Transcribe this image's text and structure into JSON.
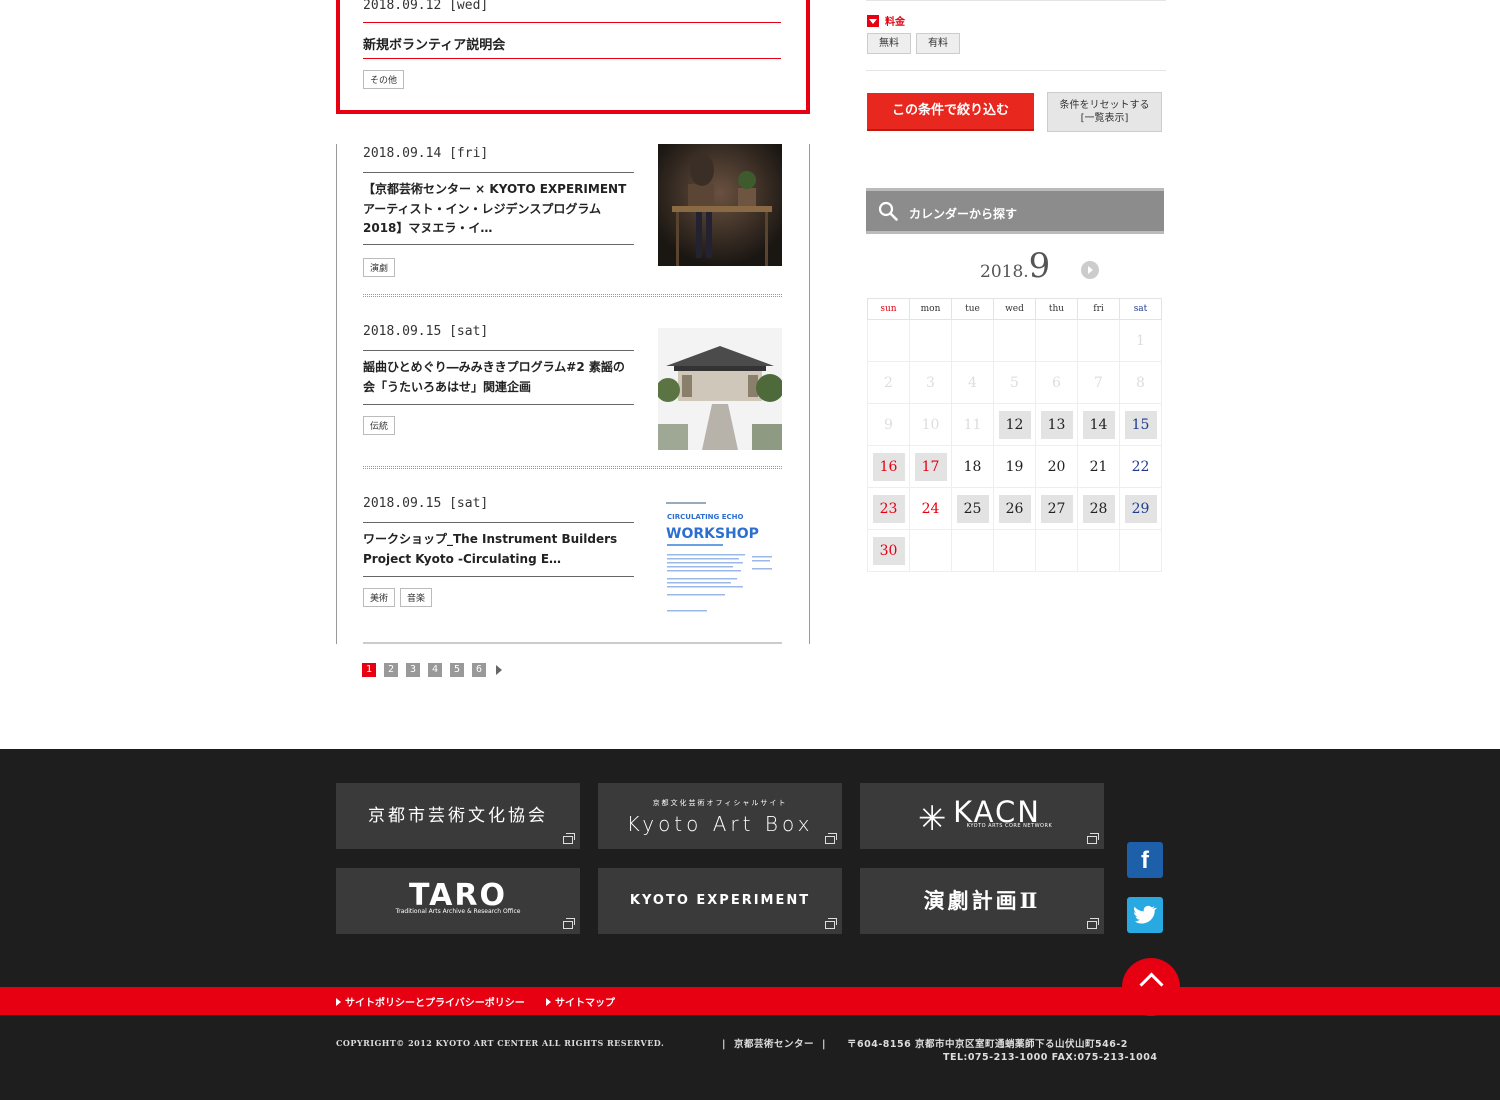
{
  "featured": {
    "date": "2018.09.12 [wed]",
    "title": "新規ボランティア説明会",
    "tags": [
      "その他"
    ]
  },
  "events": [
    {
      "date": "2018.09.14 [fri]",
      "title": "【京都芸術センター × KYOTO EXPERIMENT アーティスト・イン・レジデンスプログラム2018】マヌエラ・イ…",
      "tags": [
        "演劇"
      ]
    },
    {
      "date": "2018.09.15 [sat]",
      "title": "謡曲ひとめぐり―みみききプログラム#2 素謡の会「うたいろあはせ」関連企画",
      "tags": [
        "伝統"
      ]
    },
    {
      "date": "2018.09.15 [sat]",
      "title": "ワークショップ_The Instrument Builders Project Kyoto -Circulating E…",
      "tags": [
        "美術",
        "音楽"
      ],
      "poster": {
        "head": "CIRCULATING ECHO",
        "big": "WORKSHOP"
      }
    }
  ],
  "pagination": {
    "pages": [
      "1",
      "2",
      "3",
      "4",
      "5",
      "6"
    ],
    "current": "1"
  },
  "sidebar": {
    "fee_label": "料金",
    "fee_options": [
      "無料",
      "有料"
    ],
    "filter_button": "この条件で絞り込む",
    "reset_line1": "条件をリセットする",
    "reset_line2": "[一覧表示]"
  },
  "calendar": {
    "title": "カレンダーから探す",
    "year": "2018.",
    "month": "9",
    "weekdays": [
      "sun",
      "mon",
      "tue",
      "wed",
      "thu",
      "fri",
      "sat"
    ],
    "weeks": [
      [
        null,
        null,
        null,
        null,
        null,
        null,
        {
          "d": "1",
          "s": "off"
        }
      ],
      [
        {
          "d": "2",
          "s": "off"
        },
        {
          "d": "3",
          "s": "off"
        },
        {
          "d": "4",
          "s": "off"
        },
        {
          "d": "5",
          "s": "off"
        },
        {
          "d": "6",
          "s": "off"
        },
        {
          "d": "7",
          "s": "off"
        },
        {
          "d": "8",
          "s": "off"
        }
      ],
      [
        {
          "d": "9",
          "s": "off"
        },
        {
          "d": "10",
          "s": "off"
        },
        {
          "d": "11",
          "s": "off"
        },
        {
          "d": "12",
          "s": "ev"
        },
        {
          "d": "13",
          "s": "ev"
        },
        {
          "d": "14",
          "s": "ev"
        },
        {
          "d": "15",
          "s": "ev"
        }
      ],
      [
        {
          "d": "16",
          "s": "ev"
        },
        {
          "d": "17",
          "s": "ev-sun"
        },
        {
          "d": "18",
          "s": "on"
        },
        {
          "d": "19",
          "s": "on"
        },
        {
          "d": "20",
          "s": "on"
        },
        {
          "d": "21",
          "s": "on"
        },
        {
          "d": "22",
          "s": "on"
        }
      ],
      [
        {
          "d": "23",
          "s": "ev"
        },
        {
          "d": "24",
          "s": "on-sun"
        },
        {
          "d": "25",
          "s": "ev"
        },
        {
          "d": "26",
          "s": "ev"
        },
        {
          "d": "27",
          "s": "ev"
        },
        {
          "d": "28",
          "s": "ev"
        },
        {
          "d": "29",
          "s": "ev"
        }
      ],
      [
        {
          "d": "30",
          "s": "ev"
        },
        null,
        null,
        null,
        null,
        null,
        null
      ]
    ]
  },
  "footer": {
    "banners": {
      "kyoto_city": "京都市芸術文化協会",
      "artbox_small": "京都文化芸術オフィシャルサイト",
      "artbox_big": "Kyoto Art Box",
      "kacn_big": "KACN",
      "kacn_small": "KYOTO ARTS CORE NETWORK",
      "taro_big": "TARO",
      "taro_small": "Traditional Arts Archive & Research Office",
      "kyoto_experiment": "KYOTO EXPERIMENT",
      "engeki": "演劇計画Ⅱ"
    },
    "social": {
      "facebook": "f",
      "twitter": "t"
    },
    "links": [
      "サイトポリシーとプライバシーポリシー",
      "サイトマップ"
    ],
    "copyright": "COPYRIGHT© 2012 KYOTO ART CENTER ALL RIGHTS RESERVED.",
    "org": "京都芸術センター",
    "address": "〒604-8156 京都市中京区室町通蛸薬師下る山伏山町546-2",
    "tel": "TEL:075-213-1000 FAX:075-213-1004"
  },
  "colors": {
    "accent": "#e60012",
    "saturday": "#1f3c8f",
    "footer_bg": "#1e1e1e"
  }
}
